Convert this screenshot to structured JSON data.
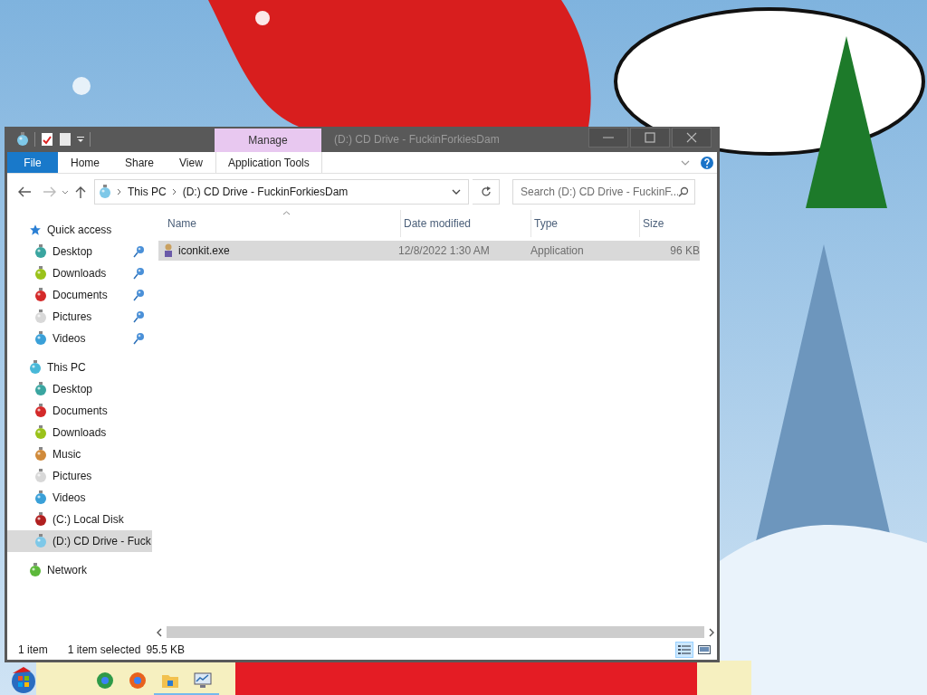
{
  "window": {
    "title": "(D:) CD Drive - FuckinForkiesDam"
  },
  "contextual_tab_group": {
    "label": "Manage"
  },
  "ribbon_tabs": [
    {
      "label": "File",
      "kind": "file",
      "selected": false
    },
    {
      "label": "Home",
      "kind": "tab",
      "selected": false
    },
    {
      "label": "Share",
      "kind": "tab",
      "selected": false
    },
    {
      "label": "View",
      "kind": "tab",
      "selected": false
    },
    {
      "label": "Application Tools",
      "kind": "context",
      "selected": false
    }
  ],
  "address_bar": {
    "path": [
      "This PC",
      "(D:) CD Drive - FuckinForkiesDam"
    ]
  },
  "search": {
    "placeholder": "Search (D:) CD Drive - FuckinF..."
  },
  "nav": [
    {
      "label": "Quick access",
      "kind": "star",
      "selected": false,
      "children": [
        {
          "label": "Desktop",
          "kind": "ball",
          "color": "#3aa5a0",
          "pinned": true,
          "selected": false
        },
        {
          "label": "Downloads",
          "kind": "ball",
          "color": "#9ac21a",
          "pinned": true,
          "selected": false
        },
        {
          "label": "Documents",
          "kind": "ball",
          "color": "#d42a2a",
          "pinned": true,
          "selected": false
        },
        {
          "label": "Pictures",
          "kind": "ball",
          "color": "#d8d8d8",
          "pinned": true,
          "selected": false
        },
        {
          "label": "Videos",
          "kind": "ball",
          "color": "#3aa0d8",
          "pinned": true,
          "selected": false
        }
      ]
    },
    {
      "label": "This PC",
      "kind": "ball",
      "color": "#48b8d8",
      "selected": false,
      "children": [
        {
          "label": "Desktop",
          "kind": "ball",
          "color": "#3aa5a0",
          "pinned": false,
          "selected": false
        },
        {
          "label": "Documents",
          "kind": "ball",
          "color": "#d42a2a",
          "pinned": false,
          "selected": false
        },
        {
          "label": "Downloads",
          "kind": "ball",
          "color": "#9ac21a",
          "pinned": false,
          "selected": false
        },
        {
          "label": "Music",
          "kind": "ball",
          "color": "#d08a3a",
          "pinned": false,
          "selected": false
        },
        {
          "label": "Pictures",
          "kind": "ball",
          "color": "#d8d8d8",
          "pinned": false,
          "selected": false
        },
        {
          "label": "Videos",
          "kind": "ball",
          "color": "#3aa0d8",
          "pinned": false,
          "selected": false
        },
        {
          "label": "(C:) Local Disk",
          "kind": "ball",
          "color": "#b02020",
          "pinned": false,
          "selected": false
        },
        {
          "label": "(D:) CD Drive - Fuck",
          "kind": "ball",
          "color": "#7ec8e8",
          "pinned": false,
          "selected": true
        }
      ]
    },
    {
      "label": "Network",
      "kind": "ball",
      "color": "#5cb83a",
      "selected": false
    }
  ],
  "columns": [
    {
      "label": "Name",
      "sorted": true
    },
    {
      "label": "Date modified",
      "sorted": false
    },
    {
      "label": "Type",
      "sorted": false
    },
    {
      "label": "Size",
      "sorted": false
    }
  ],
  "rows": [
    {
      "name": "iconkit.exe",
      "date_modified": "12/8/2022 1:30 AM",
      "type": "Application",
      "size": "96 KB",
      "selected": true
    }
  ],
  "status_bar": {
    "item_count": "1 item",
    "selection": "1 item selected",
    "selection_size": "95.5 KB"
  },
  "view_buttons": [
    {
      "kind": "details",
      "selected": true
    },
    {
      "kind": "large",
      "selected": false
    }
  ],
  "taskbar": [
    {
      "kind": "ball",
      "color": "#2e9a48",
      "running": false
    },
    {
      "kind": "ball",
      "color": "#e8621e",
      "running": false
    },
    {
      "kind": "folder",
      "running": true
    },
    {
      "kind": "monitor",
      "running": true
    }
  ]
}
